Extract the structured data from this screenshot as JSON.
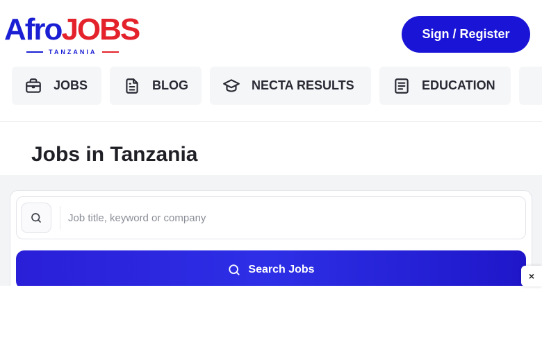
{
  "header": {
    "logo_afro": "Afro",
    "logo_jobs": "JOBS",
    "logo_country": "TANZANIA",
    "signin_label": "Sign / Register"
  },
  "nav": {
    "items": [
      {
        "label": "JOBS",
        "icon": "briefcase-icon"
      },
      {
        "label": "BLOG",
        "icon": "document-icon"
      },
      {
        "label": "NECTA RESULTS",
        "icon": "graduation-cap-icon"
      },
      {
        "label": "EDUCATION",
        "icon": "notes-icon"
      }
    ]
  },
  "main": {
    "title": "Jobs in Tanzania"
  },
  "search": {
    "placeholder": "Job title, keyword or company",
    "button_label": "Search Jobs"
  },
  "overlay": {
    "close_glyph": "×"
  },
  "colors": {
    "brand_blue": "#1a1fd4",
    "brand_red": "#e4222b",
    "button_blue": "#1a14d6"
  }
}
